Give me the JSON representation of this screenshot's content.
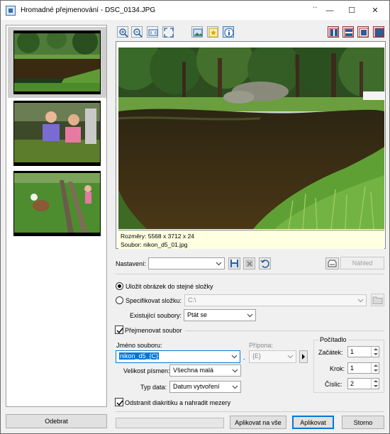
{
  "window": {
    "title": "Hromadné přejmenování - DSC_0134.JPG",
    "resize_hint": "↔",
    "minimize": "—",
    "maximize": "☐",
    "close": "✕"
  },
  "thumbnails": [
    {
      "name": "thumb-pond",
      "selected": true
    },
    {
      "name": "thumb-girls",
      "selected": false
    },
    {
      "name": "thumb-dog",
      "selected": false
    }
  ],
  "toolbar": {
    "left_icons": [
      "zoom-in-icon",
      "zoom-out-icon",
      "actual-size-icon",
      "fit-window-icon",
      "image-icon",
      "star-icon",
      "info-icon"
    ],
    "right_icons": [
      "layout-columns-icon",
      "layout-rows-icon",
      "layout-single-icon",
      "layout-fullscreen-icon"
    ]
  },
  "preview": {
    "dimensions_line": "Rozměry: 5568 x 3712 x 24",
    "file_line": "Soubor: nikon_d5_01.jpg"
  },
  "settings": {
    "label": "Nastavení:",
    "value": "",
    "preview_button": "Náhled"
  },
  "output": {
    "save_same_folder": "Uložit obrázek do stejné složky",
    "specify_folder": "Specifikovat složku:",
    "folder_value": "C:\\",
    "existing_files_label": "Existující soubory:",
    "existing_files_value": "Ptát se"
  },
  "rename": {
    "checkbox_label": "Přejmenovat soubor",
    "filename_label": "Jméno souboru:",
    "filename_value": "nikon_d5_{C}",
    "dot": ".",
    "extension_label": "Přípona:",
    "extension_value": "{E}",
    "case_label": "Velikost písmen:",
    "case_value": "Všechna malá",
    "date_type_label": "Typ data:",
    "date_type_value": "Datum vytvoření",
    "diacritics_label": "Odstranit diakritiku a nahradit mezery"
  },
  "counter": {
    "title": "Počítadlo",
    "start_label": "Začátek:",
    "start_value": "1",
    "step_label": "Krok:",
    "step_value": "1",
    "digits_label": "Číslic:",
    "digits_value": "2"
  },
  "footer": {
    "remove_button": "Odebrat",
    "apply_all_button": "Aplikovat na vše",
    "apply_button": "Aplikovat",
    "cancel_button": "Storno",
    "progress": 0
  }
}
